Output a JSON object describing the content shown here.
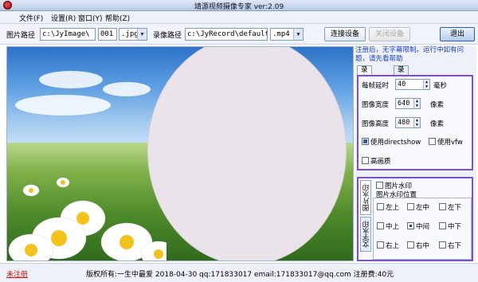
{
  "window": {
    "title": "靖源视频摄像专家 ver:2.09",
    "app_icon": "webcam-icon"
  },
  "menu": [
    "文件(F)",
    "设置(R)",
    "窗口(Y)",
    "帮助(Z)"
  ],
  "toolbar": {
    "image_path_label": "图片路径",
    "image_path_value": "c:\\JyImage\\",
    "image_index_value": "001",
    "image_ext_value": ".jpg",
    "video_path_label": "录像路径",
    "video_path_value": "c:\\JyRecord\\default",
    "video_ext_value": ".mp4",
    "connect_button": "连接设备",
    "disconnect_button": "关闭设备",
    "exit_button": "退出"
  },
  "notice": "注册后，无字幕限制。运行中如有问题，请先看帮助",
  "tabs": [
    "录像设置",
    "录像音源"
  ],
  "settings": {
    "frame_delay_label": "每帧延时",
    "frame_delay_value": "40",
    "frame_delay_unit": "毫秒",
    "width_label": "图像宽度",
    "width_value": "640",
    "width_unit": "像素",
    "height_label": "图像高度",
    "height_value": "480",
    "height_unit": "像素",
    "directshow_label": "使用directshow",
    "directshow_checked": true,
    "vfw_label": "使用vfw",
    "vfw_checked": false,
    "hq_label": "高画质",
    "hq_checked": false
  },
  "watermark": {
    "vtabs": [
      "图片水印",
      "文字水印"
    ],
    "enable_label": "图片水印",
    "enabled": false,
    "position_group_label": "图片水印位置",
    "positions": [
      "左上",
      "左中",
      "左下",
      "中上",
      "中间",
      "中下",
      "右上",
      "右中",
      "右下"
    ],
    "selected_position": "中间"
  },
  "status": {
    "register_link": "未注册",
    "info": "版权所有:一生中最爱 2018-04-30 qq:171833017  email:171833017@qq.com  注册费:40元"
  },
  "colors": {
    "accent_border": "#7a52c8",
    "notice_text": "#1a3fd0",
    "register_text": "#d81010",
    "mask_oval": "#eae4ea"
  }
}
